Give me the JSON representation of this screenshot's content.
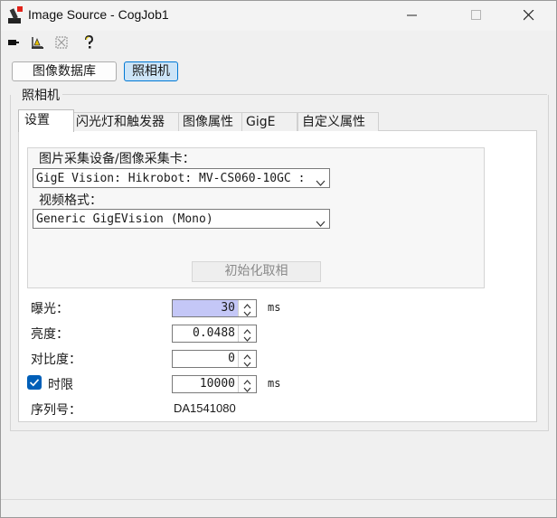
{
  "window": {
    "title": "Image Source - CogJob1"
  },
  "toolbar": {
    "icons": [
      "camera-icon",
      "properties-icon",
      "disabled-grid-icon",
      "help-icon"
    ]
  },
  "source_buttons": {
    "database": "图像数据库",
    "camera": "照相机"
  },
  "group": {
    "label": "照相机"
  },
  "tabs": [
    {
      "label": "设置"
    },
    {
      "label": "闪光灯和触发器"
    },
    {
      "label": "图像属性"
    },
    {
      "label": "GigE"
    },
    {
      "label": "自定义属性"
    }
  ],
  "acquisition": {
    "device_label": "图片采集设备/图像采集卡：",
    "device_value": "GigE Vision: Hikrobot: MV-CS060-10GC :",
    "format_label": "视频格式：",
    "format_value": "Generic GigEVision (Mono)",
    "init_button": "初始化取相"
  },
  "params": {
    "exposure": {
      "label": "曝光：",
      "value": "30",
      "unit": "ms"
    },
    "brightness": {
      "label": "亮度：",
      "value": "0.0488"
    },
    "contrast": {
      "label": "对比度：",
      "value": "0"
    },
    "timeout": {
      "label": "时限",
      "value": "10000",
      "unit": "ms",
      "checked": true
    },
    "serial": {
      "label": "序列号：",
      "value": "DA1541080"
    }
  },
  "colors": {
    "accent": "#0078d4",
    "selection": "#c4c7f7",
    "checkbox": "#005fb8"
  }
}
